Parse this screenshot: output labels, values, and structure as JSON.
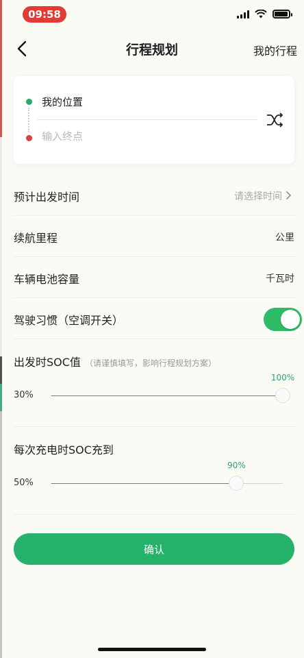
{
  "status_bar": {
    "time": "09:58"
  },
  "header": {
    "title": "行程规划",
    "right_link": "我的行程"
  },
  "route": {
    "from": "我的位置",
    "to_placeholder": "输入终点"
  },
  "form": {
    "departure_time": {
      "label": "预计出发时间",
      "placeholder": "请选择时间"
    },
    "range": {
      "label": "续航里程",
      "unit": "公里"
    },
    "battery_capacity": {
      "label": "车辆电池容量",
      "unit": "千瓦时"
    },
    "driving_habit": {
      "label": "驾驶习惯（空调开关）",
      "enabled": true
    }
  },
  "soc_start": {
    "title": "出发时SOC值",
    "hint": "（请谨慎填写，影响行程规划方案）",
    "min_label": "30%",
    "value_label": "100%",
    "value_fraction": 1.0
  },
  "soc_charge": {
    "title": "每次充电时SOC充到",
    "min_label": "50%",
    "value_label": "90%",
    "value_fraction": 0.8
  },
  "confirm_label": "确认",
  "colors": {
    "accent": "#26b26b",
    "slider": "#2aa57a",
    "end_dot": "#d9403f",
    "time_pill": "#e23b36"
  }
}
